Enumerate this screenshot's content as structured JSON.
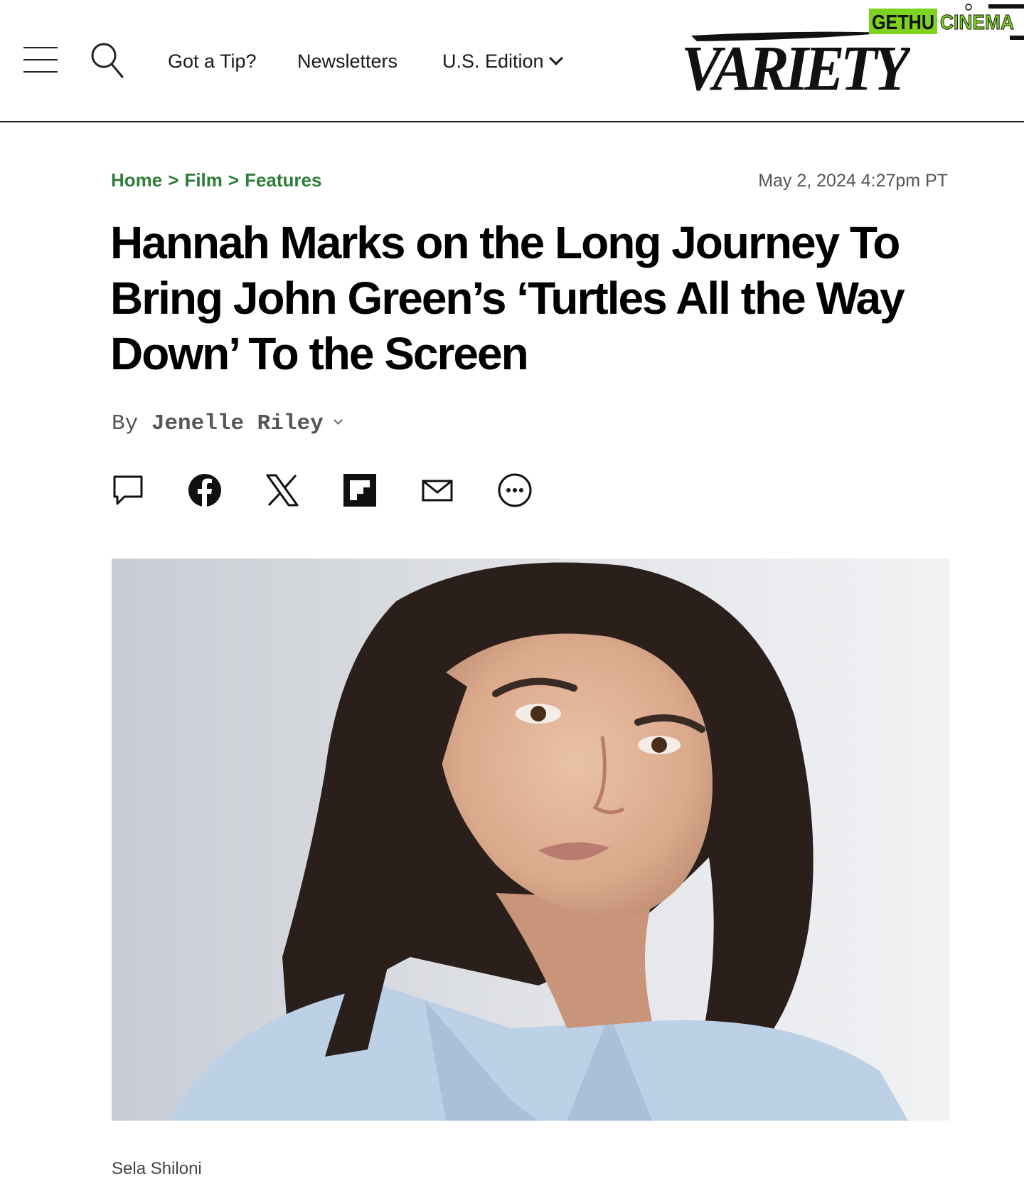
{
  "header": {
    "nav": {
      "tip": "Got a Tip?",
      "newsletters": "Newsletters",
      "edition": "U.S. Edition"
    },
    "logo_text": "VARIETY",
    "watermark": {
      "part1": "GETHU",
      "part2": "CINEMA"
    }
  },
  "article": {
    "breadcrumb": [
      "Home",
      "Film",
      "Features"
    ],
    "breadcrumb_separator": ">",
    "timestamp": "May 2, 2024 4:27pm PT",
    "headline": "Hannah Marks on the Long Journey To Bring John Green’s ‘Turtles All the Way Down’ To the Screen",
    "byline_prefix": "By",
    "author": "Jenelle Riley",
    "image_caption": "Sela Shiloni"
  },
  "share_icons": [
    "comment-icon",
    "facebook-icon",
    "x-icon",
    "flipboard-icon",
    "email-icon",
    "more-icon"
  ],
  "colors": {
    "breadcrumb": "#2e7d3a",
    "watermark_green": "#7ed321",
    "text": "#111111"
  }
}
